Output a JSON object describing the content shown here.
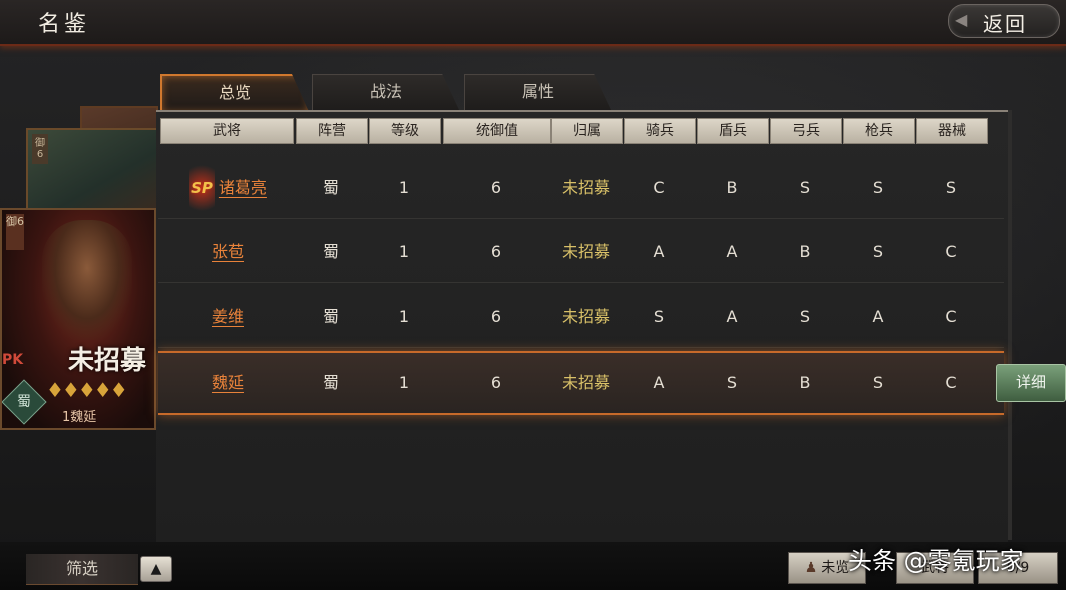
{
  "header": {
    "title": "名鉴",
    "back_label": "返回"
  },
  "tabs": [
    {
      "label": "总览",
      "active": true
    },
    {
      "label": "战法",
      "active": false
    },
    {
      "label": "属性",
      "active": false
    }
  ],
  "table": {
    "columns": [
      "武将",
      "阵营",
      "等级",
      "统御值",
      "归属",
      "骑兵",
      "盾兵",
      "弓兵",
      "枪兵",
      "器械"
    ],
    "rows": [
      {
        "badge": "SP",
        "name": "诸葛亮",
        "faction": "蜀",
        "level": "1",
        "command": "6",
        "status": "未招募",
        "cavalry": "C",
        "shield": "B",
        "archer": "S",
        "spear": "S",
        "siege": "S"
      },
      {
        "badge": "",
        "name": "张苞",
        "faction": "蜀",
        "level": "1",
        "command": "6",
        "status": "未招募",
        "cavalry": "A",
        "shield": "A",
        "archer": "B",
        "spear": "S",
        "siege": "C"
      },
      {
        "badge": "",
        "name": "姜维",
        "faction": "蜀",
        "level": "1",
        "command": "6",
        "status": "未招募",
        "cavalry": "S",
        "shield": "A",
        "archer": "S",
        "spear": "A",
        "siege": "C"
      },
      {
        "badge": "",
        "name": "魏延",
        "faction": "蜀",
        "level": "1",
        "command": "6",
        "status": "未招募",
        "cavalry": "A",
        "shield": "S",
        "archer": "B",
        "spear": "S",
        "siege": "C",
        "selected": true
      }
    ],
    "detail_label": "详细"
  },
  "card": {
    "rank_tag": "御6",
    "back_rank_tag": "御6",
    "pk_tag": "PK",
    "status": "未招募",
    "stars": "♦♦♦♦♦",
    "faction": "蜀",
    "name": "1魏延"
  },
  "footer": {
    "filter_label": "筛选",
    "toggle_icon": "▲",
    "btn1_label": "未览",
    "btn2_label": "武将",
    "btn3_label": "0/9"
  },
  "watermark": "头条 @零氪玩家",
  "colors": {
    "accent": "#d0782e",
    "name": "#e8823a",
    "recruit": "#d8c068",
    "detail": "#5a805a"
  }
}
